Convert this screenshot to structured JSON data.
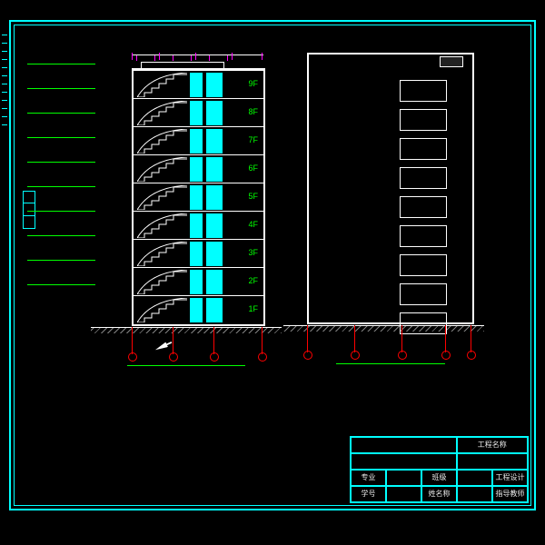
{
  "floors": [
    "9F",
    "8F",
    "7F",
    "6F",
    "5F",
    "4F",
    "3F",
    "2F",
    "1F"
  ],
  "title_block": {
    "project_label": "工程名称",
    "r1": [
      "专业",
      "",
      "班级",
      "",
      "工程设计"
    ],
    "r2": [
      "学号",
      "",
      "姓名称",
      "",
      "指导教师"
    ]
  },
  "section_caption": "",
  "elevation_caption": ""
}
